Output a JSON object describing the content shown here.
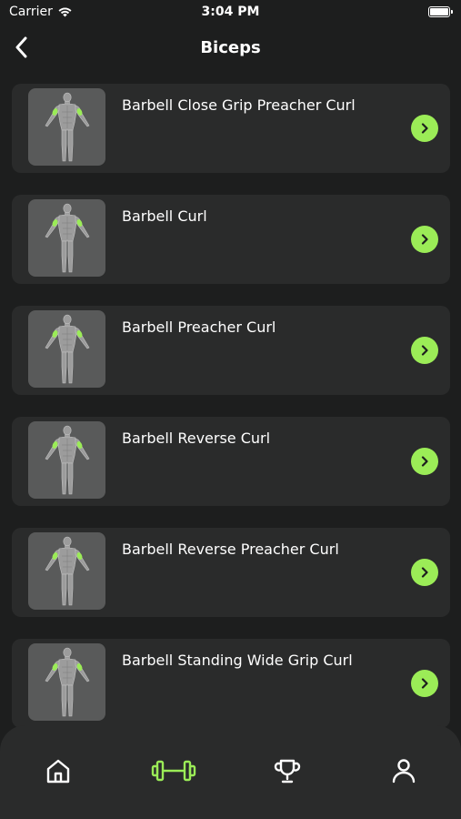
{
  "status_bar": {
    "carrier": "Carrier",
    "time": "3:04 PM"
  },
  "header": {
    "title": "Biceps"
  },
  "colors": {
    "accent": "#9bec57",
    "background": "#1d1e1e",
    "card": "#2a2b2b"
  },
  "exercises": [
    {
      "name": "Barbell Close Grip Preacher Curl"
    },
    {
      "name": "Barbell Curl"
    },
    {
      "name": "Barbell Preacher Curl"
    },
    {
      "name": "Barbell Reverse Curl"
    },
    {
      "name": "Barbell Reverse Preacher Curl"
    },
    {
      "name": "Barbell Standing Wide Grip Curl"
    }
  ],
  "tab_bar": {
    "tabs": [
      {
        "icon": "home-icon"
      },
      {
        "icon": "dumbbell-icon",
        "active": true
      },
      {
        "icon": "trophy-icon"
      },
      {
        "icon": "profile-icon"
      }
    ]
  }
}
